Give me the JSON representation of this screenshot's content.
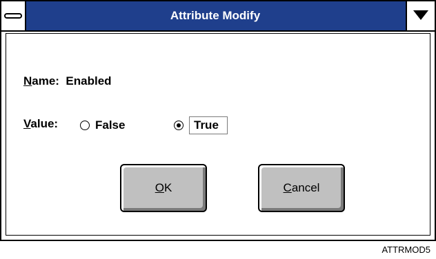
{
  "window": {
    "title": "Attribute Modify",
    "titlebar_color": "#1f3f8c",
    "sysmenu_icon": "minus-bar-icon",
    "dropdown_icon": "triangle-down-icon"
  },
  "name_row": {
    "label_accel": "N",
    "label_rest": "ame:",
    "value": "Enabled"
  },
  "value_row": {
    "label_accel": "V",
    "label_rest": "alue:"
  },
  "options": [
    {
      "label": "False",
      "selected": false
    },
    {
      "label": "True",
      "selected": true
    }
  ],
  "buttons": {
    "ok_accel": "O",
    "ok_rest": "K",
    "cancel_accel": "C",
    "cancel_rest": "ancel"
  },
  "caption": "ATTRMOD5"
}
